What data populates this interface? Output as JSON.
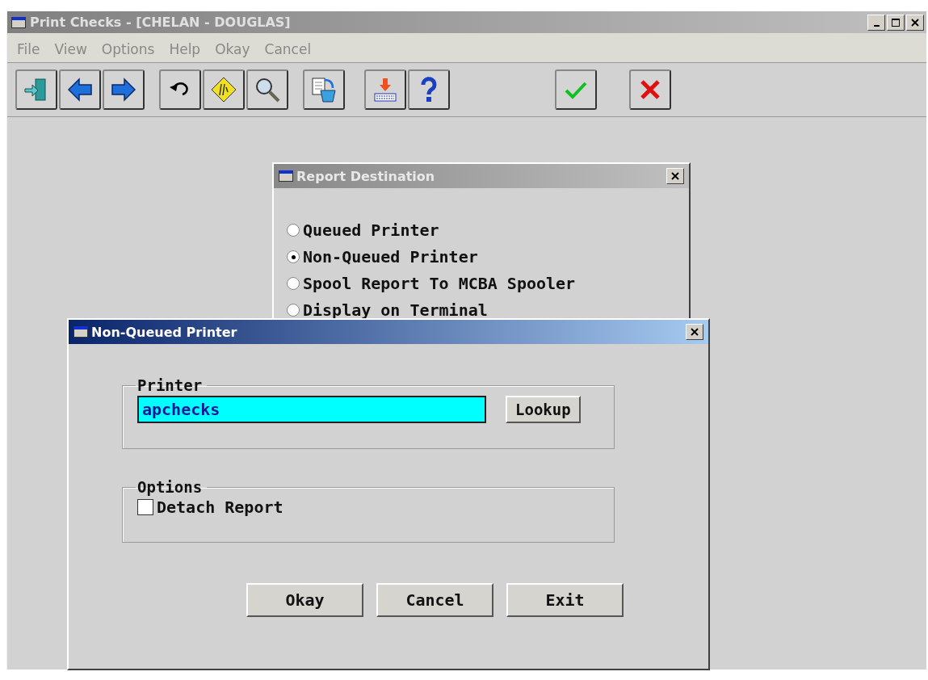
{
  "window": {
    "title": "Print Checks - [CHELAN - DOUGLAS]",
    "active": false
  },
  "menu": [
    "File",
    "View",
    "Options",
    "Help",
    "Okay",
    "Cancel"
  ],
  "toolbar": [
    {
      "kind": "exit"
    },
    {
      "kind": "back"
    },
    {
      "kind": "forward"
    },
    {
      "kind": "undo"
    },
    {
      "kind": "sign"
    },
    {
      "kind": "search"
    },
    {
      "kind": "copy"
    },
    {
      "kind": "print"
    },
    {
      "kind": "help"
    },
    {
      "kind": "ok"
    },
    {
      "kind": "cancel"
    }
  ],
  "report_destination": {
    "title": "Report Destination",
    "active": false,
    "options": [
      {
        "label": "Queued Printer",
        "selected": false
      },
      {
        "label": "Non-Queued Printer",
        "selected": true
      },
      {
        "label": "Spool Report To MCBA Spooler",
        "selected": false
      },
      {
        "label": "Display on Terminal",
        "selected": false
      }
    ]
  },
  "printer_dialog": {
    "title": "Non-Queued Printer",
    "active": true,
    "printer_group": {
      "legend": "Printer",
      "value": "apchecks",
      "lookup": "Lookup"
    },
    "options_group": {
      "legend": "Options",
      "checkbox": {
        "label": "Detach Report",
        "checked": false
      }
    },
    "buttons": [
      "Okay",
      "Cancel",
      "Exit"
    ]
  }
}
